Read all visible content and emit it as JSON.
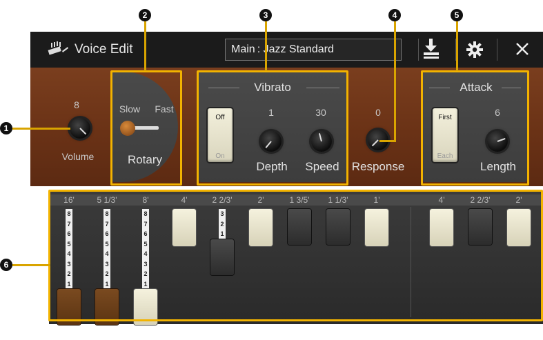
{
  "callouts": [
    "1",
    "2",
    "3",
    "4",
    "5",
    "6"
  ],
  "titlebar": {
    "title": "Voice Edit",
    "voice_prefix": "Main",
    "voice_name": ": Jazz Standard",
    "icons": [
      "organ-icon",
      "save-icon",
      "gear-icon",
      "close-icon"
    ]
  },
  "volume": {
    "value": "8",
    "label": "Volume"
  },
  "rotary": {
    "slow": "Slow",
    "fast": "Fast",
    "label": "Rotary"
  },
  "vibrato": {
    "title": "Vibrato",
    "switch_off": "Off",
    "switch_on": "On",
    "depth_value": "1",
    "depth_label": "Depth",
    "speed_value": "30",
    "speed_label": "Speed"
  },
  "response": {
    "value": "0",
    "label": "Response"
  },
  "attack": {
    "title": "Attack",
    "switch_first": "First",
    "switch_each": "Each",
    "length_value": "6",
    "length_label": "Length"
  },
  "drawbars": {
    "footages": [
      "16'",
      "5 1/3'",
      "8'",
      "4'",
      "2 2/3'",
      "2'",
      "1 3/5'",
      "1 1/3'",
      "1'",
      "4'",
      "2 2/3'",
      "2'"
    ],
    "scale": [
      "8",
      "7",
      "6",
      "5",
      "4",
      "3",
      "2",
      "1"
    ],
    "scale_short": [
      "3",
      "2",
      "1"
    ],
    "levels": [
      8,
      8,
      8,
      0,
      3,
      0,
      0,
      0,
      0,
      0,
      0,
      0
    ]
  },
  "colors": {
    "highlight": "#f2b300",
    "wood": "#6a3216"
  }
}
